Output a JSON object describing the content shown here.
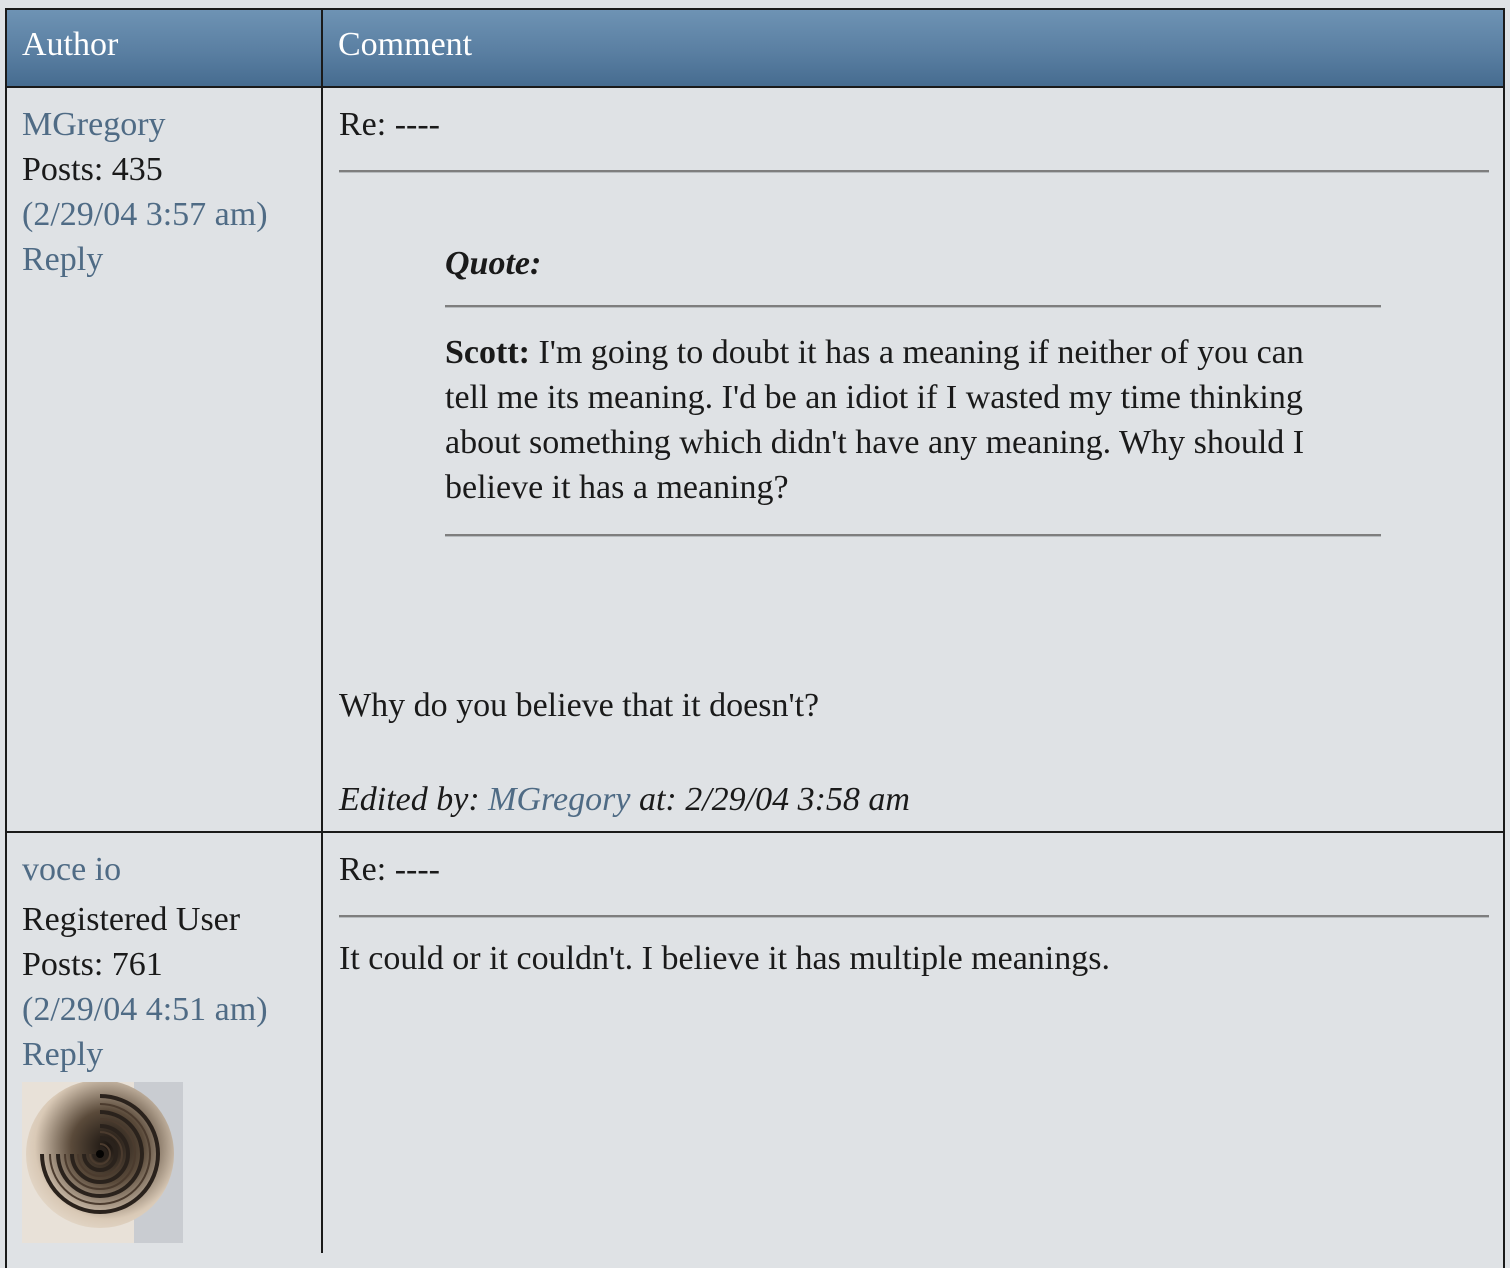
{
  "header": {
    "author": "Author",
    "comment": "Comment"
  },
  "posts": [
    {
      "author": "MGregory",
      "role": "",
      "posts": "Posts: 435",
      "date": "(2/29/04 3:57 am)",
      "reply": "Reply",
      "subject": "Re: ----",
      "quote": {
        "label": "Quote:",
        "speaker": "Scott:",
        "text": " I'm going to doubt it has a meaning if neither of you can tell me its meaning. I'd be an idiot if I wasted my time thinking about something which didn't have any meaning. Why should I believe it has a meaning?"
      },
      "body": "Why do you believe that it doesn't?",
      "edited_prefix": "Edited by: ",
      "edited_user": "MGregory",
      "edited_suffix": " at: 2/29/04 3:58 am"
    },
    {
      "author": "voce io",
      "role": "Registered User",
      "posts": "Posts: 761",
      "date": "(2/29/04 4:51 am)",
      "reply": "Reply",
      "avatar_icon": "spiral-staircase-avatar",
      "subject": "Re: ----",
      "body": "It could or it couldn't. I believe it has multiple meanings."
    }
  ],
  "colors": {
    "header_top": "#6e93b4",
    "header_bottom": "#466c90",
    "link": "#4f6b85",
    "background": "#dfe2e5"
  }
}
